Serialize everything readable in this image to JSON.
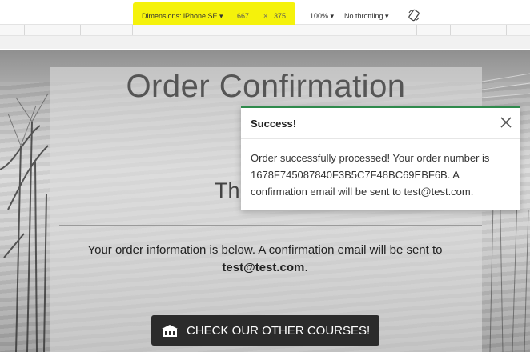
{
  "devtools": {
    "device_label": "Dimensions: iPhone SE ▾",
    "width": "667",
    "separator": "×",
    "height": "375",
    "zoom": "100% ▾",
    "throttling": "No throttling ▾",
    "rotate_icon": "rotate-icon",
    "highlight_color": "#f5f20b"
  },
  "page": {
    "title": "Order Confirmation",
    "thanks_partial": "Th",
    "info_text": "Your order information is below. A confirmation email will be sent to",
    "info_email": "test@test.com",
    "info_end": ".",
    "courses_button": "CHECK OUR OTHER COURSES!",
    "courses_icon": "building-icon"
  },
  "toast": {
    "title": "Success!",
    "message": "Order successfully processed! Your order number is 1678F745087840F3B5C7F48BC69EBF6B. A confirmation email will be sent to test@test.com.",
    "close_icon": "close-icon",
    "accent_color": "#2f8a4c"
  }
}
